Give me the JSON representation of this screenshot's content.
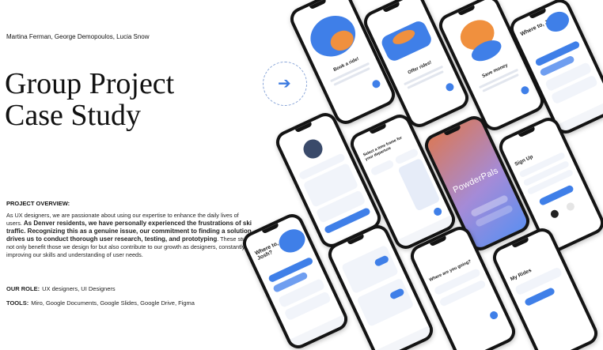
{
  "authors": "Martina Ferman, George Demopoulos, Lucia Snow",
  "title_line1": "Group Project",
  "title_line2": "Case Study",
  "overview": {
    "label": "PROJECT OVERVIEW:",
    "text_1": "As UX designers, we are passionate about using our expertise to enhance the daily lives of users. ",
    "text_2": "As Denver residents, we have personally experienced the frustrations of ski traffic. Recognizing this as a genuine issue, our commitment to finding a solution drives us to conduct thorough user research, testing, and prototyping",
    "text_3": ". These study not only benefit those we design for but also contribute to our growth as designers, constantly improving our skills and understanding of user needs."
  },
  "role": {
    "label": "OUR ROLE:",
    "value": "UX designers, UI Designers"
  },
  "tools": {
    "label": "TOOLS:",
    "value": "Miro, Google Documents, Google Slides, Google Drive, Figma"
  },
  "phones": {
    "book": "Book a ride!",
    "offer": "Offer rides!",
    "save": "Save money",
    "where": "Where to, Josh?",
    "brand": "PowderPals",
    "sign_up": "Sign Up",
    "my_rides": "My Rides",
    "going": "Where are you going?",
    "select_time": "Select a time frame for your departure"
  },
  "colors": {
    "accent": "#3f7fe8",
    "orange": "#f0903e",
    "dark": "#141414"
  }
}
